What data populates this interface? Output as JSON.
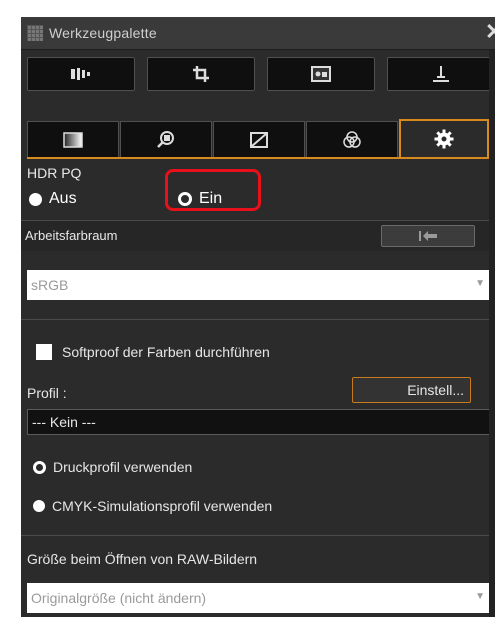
{
  "window": {
    "title": "Werkzeugpalette",
    "close_glyph": "✕"
  },
  "toolbar_row1": [
    {
      "icon": "histogram-icon"
    },
    {
      "icon": "crop-icon"
    },
    {
      "icon": "image-icon"
    },
    {
      "icon": "stamp-icon"
    }
  ],
  "toolbar_row2": [
    {
      "icon": "gradient-icon"
    },
    {
      "icon": "zoom-grid-icon"
    },
    {
      "icon": "curve-icon"
    },
    {
      "icon": "color-channels-icon"
    },
    {
      "icon": "gear-icon",
      "active": true
    }
  ],
  "hdr": {
    "label": "HDR PQ",
    "options": [
      {
        "label": "Aus",
        "selected": true
      },
      {
        "label": "Ein",
        "selected": false
      }
    ]
  },
  "workspace": {
    "label": "Arbeitsfarbraum",
    "value": "sRGB"
  },
  "softproof": {
    "checkbox_label": "Softproof der Farben durchführen",
    "profile_label": "Profil :",
    "settings_button": "Einstell...",
    "profile_value": "--- Kein ---",
    "options": [
      {
        "label": "Druckprofil verwenden",
        "selected": false
      },
      {
        "label": "CMYK-Simulationsprofil verwenden",
        "selected": true
      }
    ]
  },
  "raw": {
    "label": "Größe beim Öffnen von RAW-Bildern",
    "value": "Originalgröße (nicht ändern)"
  },
  "colors": {
    "accent": "#d98a1e",
    "highlight": "#e8101a",
    "panel": "#2b2b2b"
  }
}
